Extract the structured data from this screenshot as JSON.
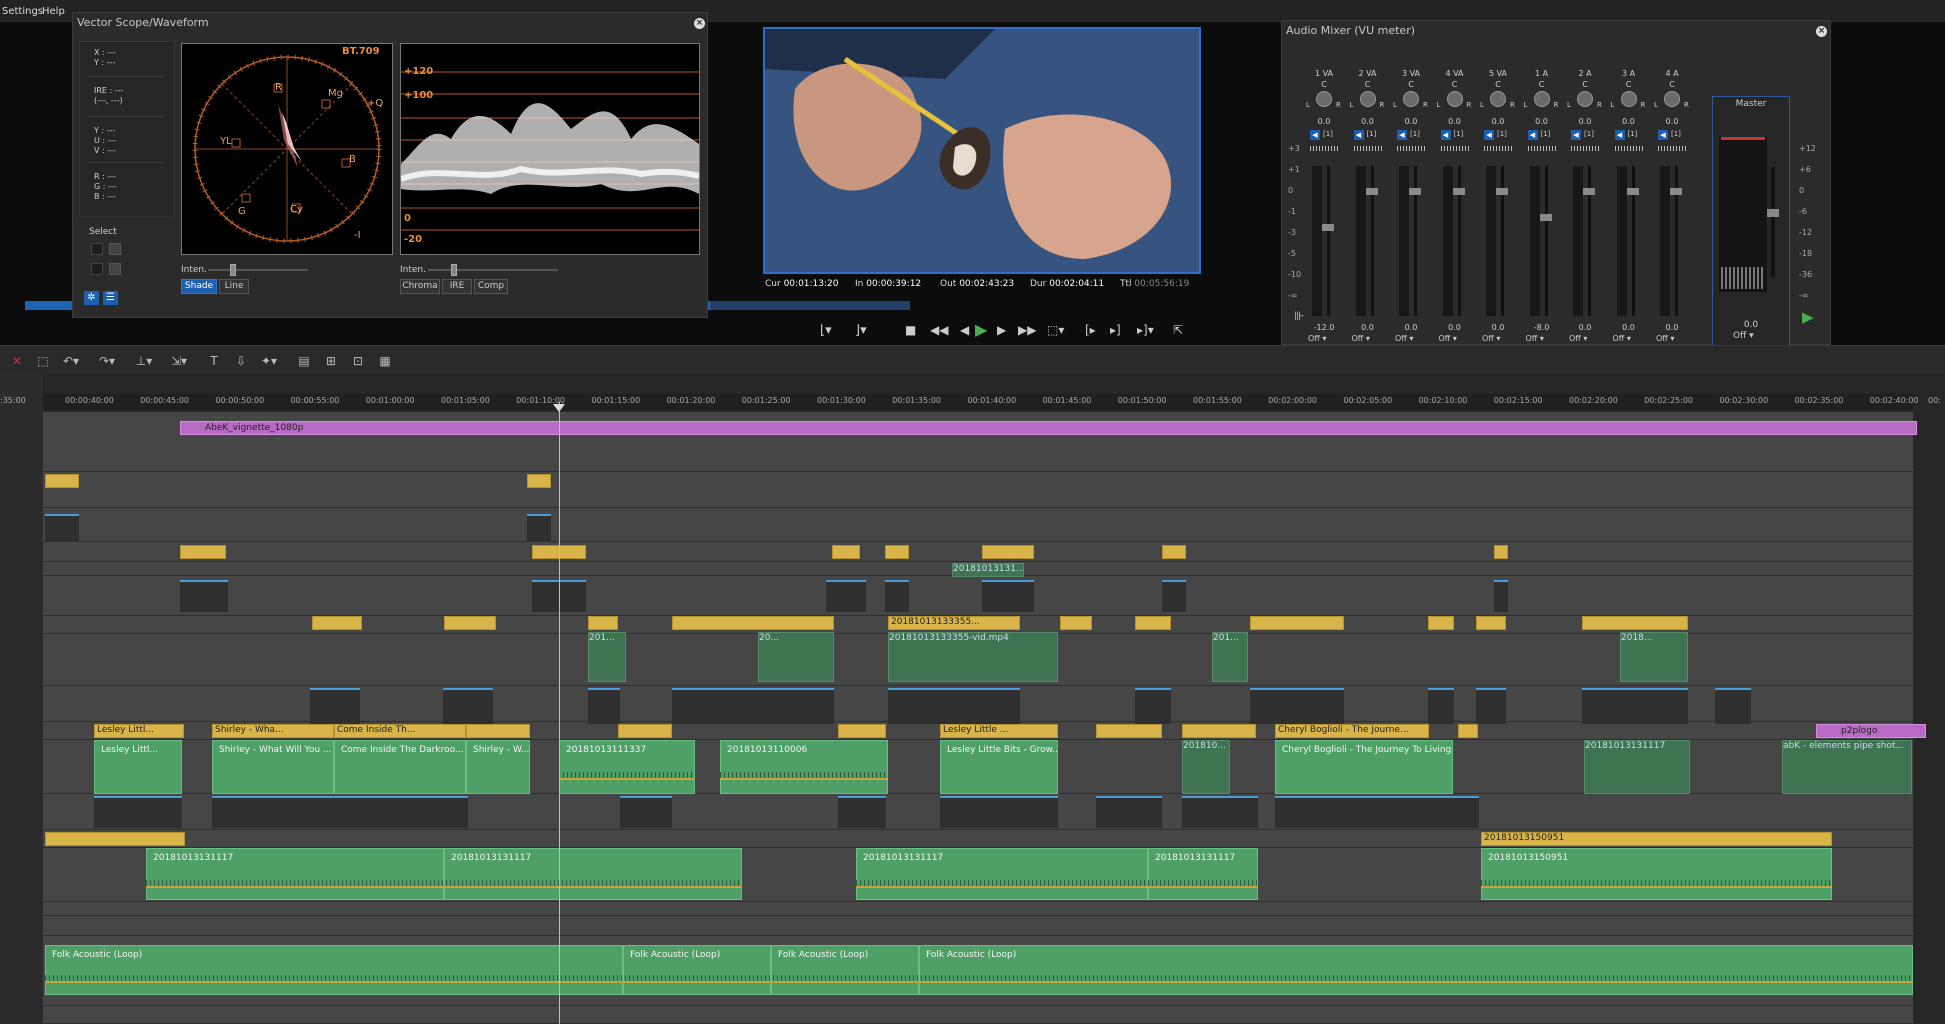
{
  "menu": {
    "settings": "Settings",
    "help": "Help"
  },
  "vectorscope": {
    "title": "Vector Scope/Waveform",
    "standard": "BT.709",
    "readouts": {
      "xy": "X : ---\nY : ---",
      "ire": "IRE : ---\n(---, ---)",
      "yuv": "Y : ---\nU : ---\nV : ---",
      "rgb": "R : ---\nG : ---\nB : ---"
    },
    "select_label": "Select",
    "scope_labels": {
      "r": "R",
      "mg": "Mg",
      "q": "+Q",
      "yl": "YL",
      "b": "B",
      "g": "G",
      "cy": "Cy",
      "i": "-I"
    },
    "waveform_labels": {
      "p120": "+120",
      "p100": "+100",
      "zero": "0",
      "m20": "-20"
    },
    "inten_label_1": "Inten.",
    "inten_label_2": "Inten.",
    "buttons": {
      "shade": "Shade",
      "line": "Line",
      "chroma": "Chroma",
      "ire": "IRE",
      "comp": "Comp"
    }
  },
  "timecodes": {
    "cur_label": "Cur",
    "cur": "00:01:13:20",
    "in_label": "In",
    "in": "00:00:39:12",
    "out_label": "Out",
    "out": "00:02:43:23",
    "dur_label": "Dur",
    "dur": "00:02:04:11",
    "ttl_label": "Ttl",
    "ttl": "00:05:56:19"
  },
  "mixer": {
    "title": "Audio Mixer (VU meter)",
    "channels": [
      {
        "name": "1 VA",
        "pan": "C",
        "vol": "0.0",
        "level": "-12.0",
        "mode": "Off"
      },
      {
        "name": "2 VA",
        "pan": "C",
        "vol": "0.0",
        "level": "0.0",
        "mode": "Off"
      },
      {
        "name": "3 VA",
        "pan": "C",
        "vol": "0.0",
        "level": "0.0",
        "mode": "Off"
      },
      {
        "name": "4 VA",
        "pan": "C",
        "vol": "0.0",
        "level": "0.0",
        "mode": "Off"
      },
      {
        "name": "5 VA",
        "pan": "C",
        "vol": "0.0",
        "level": "0.0",
        "mode": "Off"
      },
      {
        "name": "1 A",
        "pan": "C",
        "vol": "0.0",
        "level": "-8.0",
        "mode": "Off"
      },
      {
        "name": "2 A",
        "pan": "C",
        "vol": "0.0",
        "level": "0.0",
        "mode": "Off"
      },
      {
        "name": "3 A",
        "pan": "C",
        "vol": "0.0",
        "level": "0.0",
        "mode": "Off"
      },
      {
        "name": "4 A",
        "pan": "C",
        "vol": "0.0",
        "level": "0.0",
        "mode": "Off"
      }
    ],
    "master": {
      "name": "Master",
      "level": "0.0",
      "mode": "Off"
    },
    "scale_left": [
      "+3",
      "+1",
      "0",
      "-1",
      "-3",
      "-5",
      "-10",
      "-∞"
    ],
    "scale_right": [
      "+12",
      "+6",
      "0",
      "-6",
      "-12",
      "-18",
      "-36",
      "-∞"
    ],
    "lr": {
      "l": "L",
      "r": "R"
    },
    "route": "[1]"
  },
  "ruler": {
    "start": ":35:00",
    "ticks": [
      "00:00:40:00",
      "00:00:45:00",
      "00:00:50:00",
      "00:00:55:00",
      "00:01:00:00",
      "00:01:05:00",
      "00:01:10:00",
      "00:01:15:00",
      "00:01:20:00",
      "00:01:25:00",
      "00:01:30:00",
      "00:01:35:00",
      "00:01:40:00",
      "00:01:45:00",
      "00:01:50:00",
      "00:01:55:00",
      "00:02:00:00",
      "00:02:05:00",
      "00:02:10:00",
      "00:02:15:00",
      "00:02:20:00",
      "00:02:25:00",
      "00:02:30:00",
      "00:02:35:00",
      "00:02:40:00"
    ],
    "end": "00:"
  },
  "clips": {
    "vignette": "AbeK_vignette_1080p",
    "clip_2018_131_dim": "20181013131...",
    "clip_3355": "20181013133355...",
    "clip_3355_long": "20181013133355-vid.mp4",
    "clip_201": "201...",
    "clip_20": "20...",
    "clip_2018_small": "2018...",
    "lesley1": "Lesley Littl...",
    "lesley1_g": "Lesley Littl...",
    "shirley1": "Shirley - Wha...",
    "shirley1_g": "Shirley - What Will You ...",
    "come1": "Come Inside Th...",
    "come1_g": "Come Inside The Darkroo...",
    "shirley2_g": "Shirley - W...",
    "c1111337": "20181013111337",
    "c110006": "20181013110006",
    "lesley2": "Lesley Little ...",
    "lesley2_g": "Lesley Little Bits - Grow...",
    "c2018_10": "201810...",
    "cheryl": "Cheryl Boglioli - The Journe...",
    "cheryl_g": "Cheryl Boglioli - The Journey To Living...",
    "c131117_dim": "20181013131117",
    "p2plogo": "p2plogo",
    "p2p_g": "abK - elements pipe shot...",
    "c131117": "20181013131117",
    "c131117b": "20181013131117",
    "c131117c": "20181013131117",
    "c131117d": "20181013131117",
    "c150951": "20181013150951",
    "c150951_g": "20181013150951",
    "folk1": "Folk Acoustic  (Loop)",
    "folk2": "Folk Acoustic  (Loop)",
    "folk3": "Folk Acoustic  (Loop)",
    "folk4": "Folk Acoustic  (Loop)"
  },
  "colors": {
    "accent": "#2d78d8",
    "play": "#4caf50",
    "clip_green": "#4ea067",
    "clip_yellow": "#d8b44a",
    "clip_purple": "#b86bc5",
    "playhead": "#7fd3ff"
  }
}
